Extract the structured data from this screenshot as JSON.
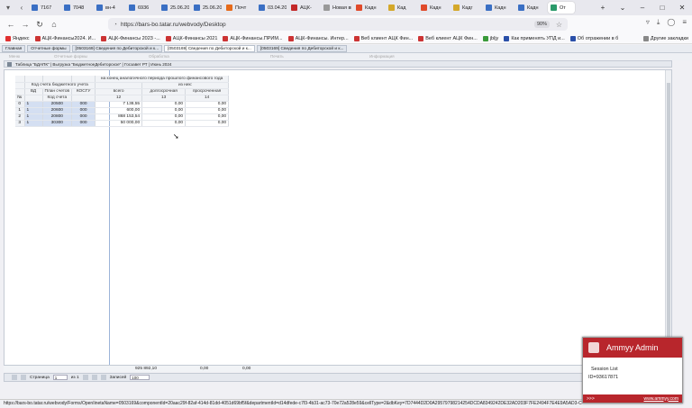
{
  "browser": {
    "tabs": [
      {
        "label": "7167",
        "color": "#3a6fc4"
      },
      {
        "label": "7048",
        "color": "#3a6fc4"
      },
      {
        "label": "вн-4",
        "color": "#3a6fc4"
      },
      {
        "label": "6936",
        "color": "#3a6fc4"
      },
      {
        "label": "25.06.202",
        "color": "#3a6fc4"
      },
      {
        "label": "25.06.202",
        "color": "#3a6fc4"
      },
      {
        "label": "Почт",
        "color": "#e66a1a"
      },
      {
        "label": "03.04.202",
        "color": "#3a6fc4"
      },
      {
        "label": "АЦК-",
        "color": "#c32828"
      },
      {
        "label": "Новая вкл",
        "color": "#999999"
      },
      {
        "label": "Кадн",
        "color": "#e04a2a"
      },
      {
        "label": "Кад",
        "color": "#d4a82a"
      },
      {
        "label": "Кадн",
        "color": "#e04a2a"
      },
      {
        "label": "Кадг",
        "color": "#d4a82a"
      },
      {
        "label": "Кадн",
        "color": "#3a6fc4"
      },
      {
        "label": "Кадн",
        "color": "#3a6fc4"
      },
      {
        "label": "От",
        "color": "#2a9a6a",
        "active": true
      }
    ],
    "url": "https://bars-bo.tatar.ru/webvody/Desktop",
    "zoom": "90%",
    "bookmarks": [
      "Яндекс",
      "АЦК-Финансы2024. И...",
      "АЦК-Финансы 2023 -...",
      "АЦК-Финансы 2021",
      "АЦК-Финансы.ПРИМ...",
      "АЦК-Финансы. Интер...",
      "Веб клиент АЦК Фин...",
      "Веб клиент АЦК Фин...",
      "jbljy",
      "Как применять УПД и...",
      "Об отражении в б"
    ],
    "other_bookmarks": "Другие закладки",
    "status_url": "https://bars-bo.tatar.ru/webvody/Forms/OpenIinetaName=0503169&componentId=20aac29f-82af-414d-81dd-4051d69bf5f&departmentId=d14dfede-c7f3-4b31-ac73-70e72a528e59&cellType=2&dbKey=7D7444D2D0A29579798214254DCDA8349242DE32AD203F7FE2494F7E4E9A5AD3-C39E-4ABA-0"
  },
  "app": {
    "tabs": [
      "Главная",
      "Отчетные формы",
      "[0503169] Сведения по Дебиторской и к...",
      "[0503169] Сведения по Дебиторской и к...",
      "[0503169] Сведения по Дебиторской и к..."
    ],
    "menu": [
      "Меню",
      "Отчетные формы",
      "Обработка",
      "Печать",
      "Информация"
    ],
    "toolbar_text": "Таблица \"БДАПК\" | Выгрузка \"БюджетноеДебиторское\" | Госзавет РТ | Июнь 2024"
  },
  "grid": {
    "group_header": "на конец аналогичного периода прошлого финансового года",
    "sub_group": "из них:",
    "account_header": "Код счета бюджетного учета",
    "cols": [
      "№",
      "ВД",
      "План счетов",
      "КОСГУ",
      "всего",
      "долгосрочная",
      "просроченная"
    ],
    "sub_cols": [
      "",
      "",
      "Код счета",
      "",
      "12",
      "13",
      "14"
    ],
    "rows": [
      {
        "n": "0",
        "vd": "1",
        "acc": "20500",
        "kosgu": "000",
        "total": "7 138,55",
        "long": "0,00",
        "overdue": "0,00"
      },
      {
        "n": "1",
        "vd": "1",
        "acc": "20600",
        "kosgu": "000",
        "total": "600,00",
        "long": "0,00",
        "overdue": "0,00"
      },
      {
        "n": "2",
        "vd": "1",
        "acc": "20800",
        "kosgu": "000",
        "total": "868 153,54",
        "long": "0,00",
        "overdue": "0,00"
      },
      {
        "n": "3",
        "vd": "1",
        "acc": "30300",
        "kosgu": "000",
        "total": "50 000,00",
        "long": "0,00",
        "overdue": "0,00"
      }
    ],
    "totals": {
      "total": "925 892,10",
      "long": "0,00",
      "overdue": "0,00"
    }
  },
  "pager": {
    "page_label": "Страница",
    "page_value": "1",
    "of_label": "из 1",
    "rows_label": "Записей",
    "rows_value": "100"
  },
  "ammyy": {
    "title": "Ammyy Admin",
    "session": "Session List",
    "id": "ID=93617871",
    "more": ">>>",
    "site": "www.ammyy.com"
  }
}
